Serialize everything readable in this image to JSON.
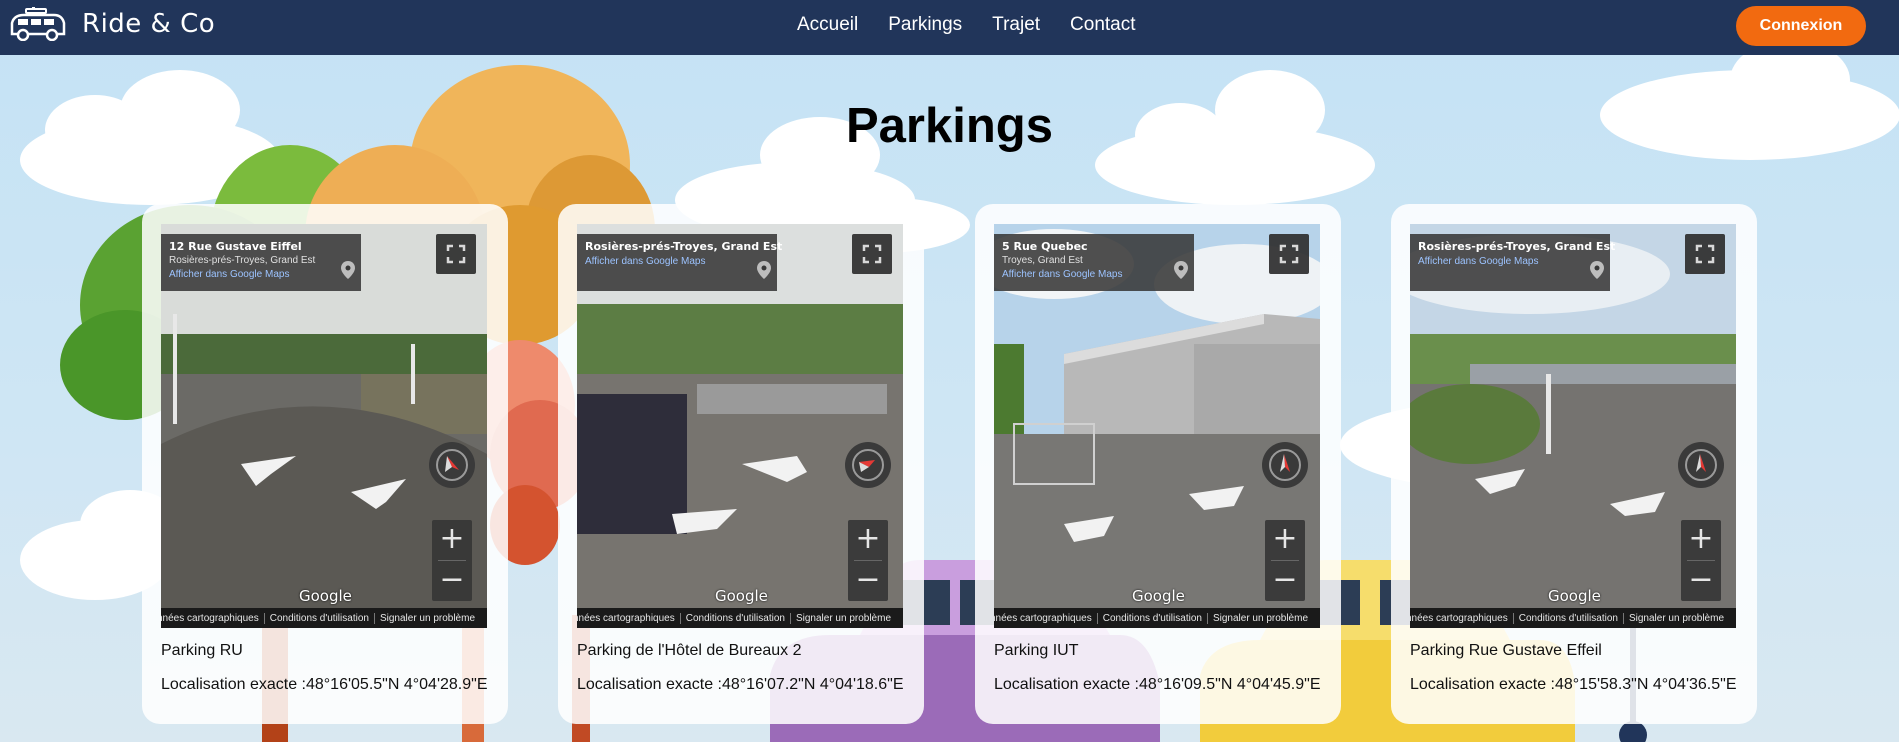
{
  "nav": {
    "brand": "Ride & Co",
    "links": [
      "Accueil",
      "Parkings",
      "Trajet",
      "Contact"
    ],
    "login_label": "Connexion"
  },
  "page": {
    "title": "Parkings"
  },
  "streetview": {
    "google_label": "Google",
    "footer": [
      "nnées cartographiques",
      "Conditions d'utilisation",
      "Signaler un problème"
    ],
    "maps_link": "Afficher dans Google Maps",
    "zoom_in": "+",
    "zoom_out": "−"
  },
  "cards": [
    {
      "addr_title": "12 Rue Gustave Eiffel",
      "addr_sub": "Rosières-prés-Troyes, Grand Est",
      "name": "Parking RU",
      "location": "Localisation exacte :48°16'05.5\"N 4°04'28.9\"E"
    },
    {
      "addr_title": "Rosières-prés-Troyes, Grand Est",
      "addr_sub": "",
      "name": "Parking de l'Hôtel de Bureaux 2",
      "location": "Localisation exacte :48°16'07.2\"N 4°04'18.6\"E"
    },
    {
      "addr_title": "5 Rue Quebec",
      "addr_sub": "Troyes, Grand Est",
      "name": "Parking IUT",
      "location": "Localisation exacte :48°16'09.5\"N 4°04'45.9\"E"
    },
    {
      "addr_title": "Rosières-prés-Troyes, Grand Est",
      "addr_sub": "",
      "name": "Parking Rue Gustave Effeil",
      "location": "Localisation exacte :48°15'58.3\"N 4°04'36.5\"E"
    }
  ],
  "icons": {
    "logo": "van-logo-icon",
    "pin": "map-pin-icon",
    "fullscreen": "fullscreen-icon",
    "compass": "compass-icon"
  },
  "colors": {
    "navbar": "#21355a",
    "accent": "#f26a10",
    "sky": "#c4e2f5"
  }
}
